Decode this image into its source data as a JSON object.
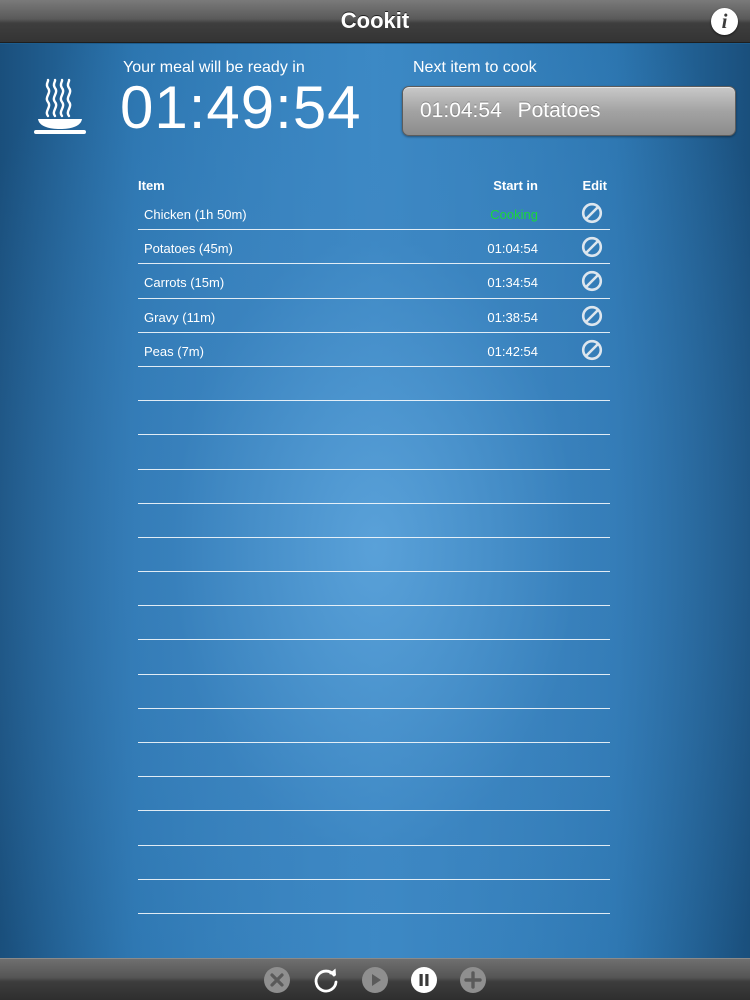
{
  "navbar": {
    "title": "Cookit",
    "info_label": "i"
  },
  "status": {
    "ready_label": "Your meal will be ready in",
    "ready_time": "01:49:54",
    "next_label": "Next item to cook",
    "next_time": "01:04:54",
    "next_item": "Potatoes"
  },
  "table": {
    "headers": {
      "item": "Item",
      "start_in": "Start in",
      "edit": "Edit"
    },
    "rows": [
      {
        "name": "Chicken (1h 50m)",
        "start": "Cooking",
        "status": "cooking"
      },
      {
        "name": "Potatoes (45m)",
        "start": "01:04:54",
        "status": "waiting"
      },
      {
        "name": "Carrots (15m)",
        "start": "01:34:54",
        "status": "waiting"
      },
      {
        "name": "Gravy (11m)",
        "start": "01:38:54",
        "status": "waiting"
      },
      {
        "name": "Peas (7m)",
        "start": "01:42:54",
        "status": "waiting"
      }
    ],
    "empty_rows": 16
  },
  "icons": {
    "header": "steaming-plate-icon",
    "edit": "no-entry-circle-icon",
    "toolbar": [
      "stop-icon",
      "reset-icon",
      "play-icon",
      "pause-icon",
      "add-icon"
    ]
  },
  "colors": {
    "cooking": "#19d83a",
    "background": "#2a74ae"
  }
}
